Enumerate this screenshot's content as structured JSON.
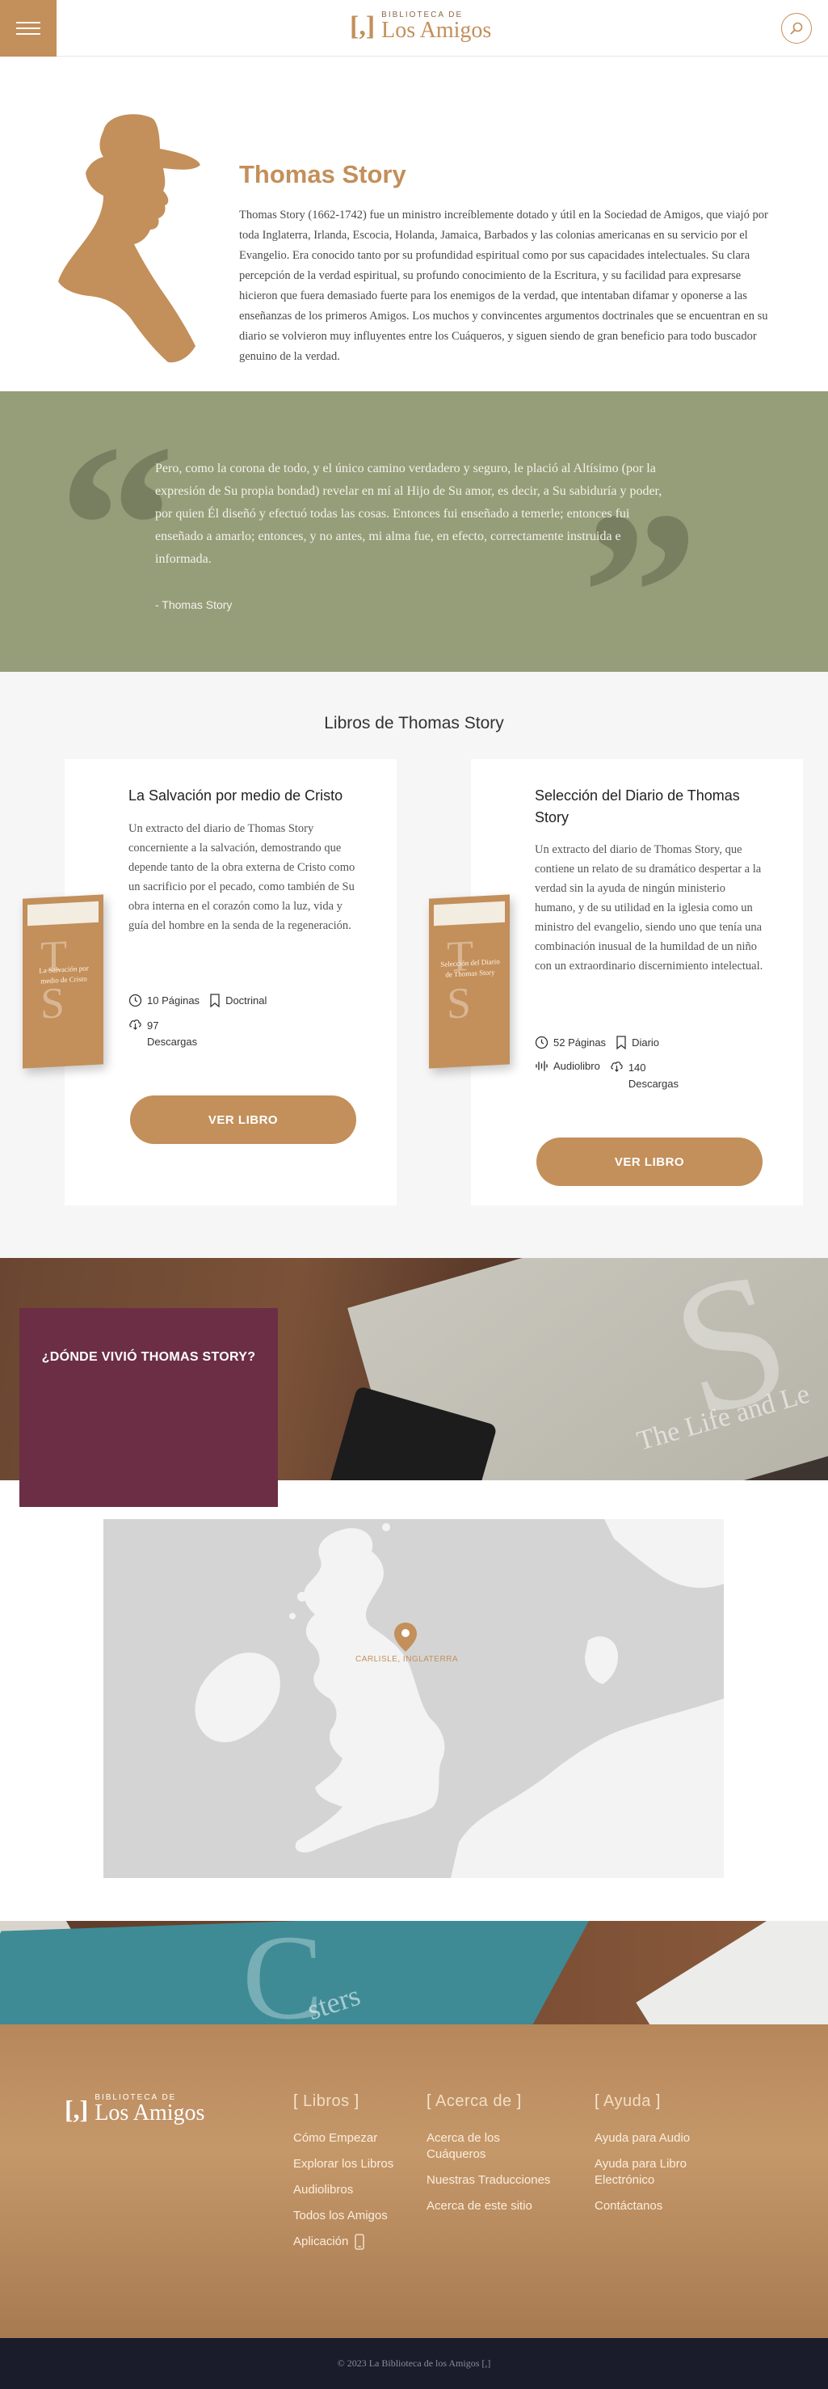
{
  "header": {
    "logo_small": "BIBLIOTECA DE",
    "logo_big": "Los Amigos",
    "logo_mark": "[,]"
  },
  "author": {
    "name": "Thomas Story",
    "bio": "Thomas Story (1662-1742) fue un ministro increíblemente dotado y útil en la Sociedad de Amigos, que viajó por toda Inglaterra, Irlanda, Escocia, Holanda, Jamaica, Barbados y las colonias americanas en su servicio por el Evangelio. Era conocido tanto por su profundidad espiritual como por sus capacidades intelectuales. Su clara percepción de la verdad espiritual, su profundo conocimiento de la Escritura, y su facilidad para expresarse hicieron que fuera demasiado fuerte para los enemigos de la verdad, que intentaban difamar y oponerse a las enseñanzas de los primeros Amigos. Los muchos y convincentes argumentos doctrinales que se encuentran en su diario se volvieron muy influyentes entre los Cuáqueros, y siguen siendo de gran beneficio para todo buscador genuino de la verdad."
  },
  "quote": {
    "text": "Pero, como la corona de todo, y el único camino verdadero y seguro, le plació al Altísimo (por la expresión de Su propia bondad) revelar en mí al Hijo de Su amor, es decir, a Su sabiduría y poder, por quien Él diseñó y efectuó todas las cosas. Entonces fui enseñado a temerle; entonces fui enseñado a amarlo; entonces, y no antes, mi alma fue, en efecto, correctamente instruida e informada.",
    "author": "- Thomas Story"
  },
  "books": {
    "section_title": "Libros de Thomas Story",
    "items": [
      {
        "title": "La Salvación por medio de Cristo",
        "description": "Un extracto del diario de Thomas Story concerniente a la salvación, demostrando que depende tanto de la obra externa de Cristo como un sacrificio por el pecado, como también de Su obra interna en el corazón como la luz, vida y guía del hombre en la senda de la regeneración.",
        "pages": "10 Páginas",
        "category": "Doctrinal",
        "downloads": "97",
        "downloads_label": "Descargas",
        "button": "VER LIBRO",
        "cover_title": "La Salvación por medio de Cristo",
        "cover_t": "T",
        "cover_s": "S"
      },
      {
        "title": "Selección del Diario de Thomas Story",
        "description": "Un extracto del diario de Thomas Story, que contiene un relato de su dramático despertar a la verdad sin la ayuda de ningún ministerio humano, y de su utilidad en la iglesia como un ministro del evangelio, siendo uno que tenía una combinación inusual de la humildad de un niño con un extraordinario discernimiento intelectual.",
        "pages": "52 Páginas",
        "category": "Diario",
        "audio": "Audiolibro",
        "downloads": "140",
        "downloads_label": "Descargas",
        "button": "VER LIBRO",
        "cover_title": "Selección del Diario de Thomas Story",
        "cover_t": "T",
        "cover_s": "S"
      }
    ]
  },
  "where": {
    "title": "¿DÓNDE VIVIÓ THOMAS STORY?",
    "book_letter": "S",
    "book_text": "The Life and Le"
  },
  "map": {
    "marker_label": "CARLISLE, INGLATERRA"
  },
  "footer_band": {
    "letter": "C",
    "text": "sters"
  },
  "footer": {
    "logo_small": "BIBLIOTECA DE",
    "logo_big": "Los Amigos",
    "logo_mark": "[,]",
    "columns": [
      {
        "title": "Libros",
        "links": [
          "Cómo Empezar",
          "Explorar los Libros",
          "Audiolibros",
          "Todos los Amigos",
          "Aplicación"
        ]
      },
      {
        "title": "Acerca de",
        "links": [
          "Acerca de los Cuáqueros",
          "Nuestras Traducciones",
          "Acerca de este sitio"
        ]
      },
      {
        "title": "Ayuda",
        "links": [
          "Ayuda para Audio",
          "Ayuda para Libro Electrónico",
          "Contáctanos"
        ]
      }
    ]
  },
  "bottom": {
    "copyright": "© 2023 La Biblioteca de los Amigos [,]"
  },
  "colors": {
    "accent": "#c38f5a",
    "quote_bg": "#969d79",
    "where_box": "#6b2e45",
    "bottom_bar": "#1a1b2b"
  }
}
